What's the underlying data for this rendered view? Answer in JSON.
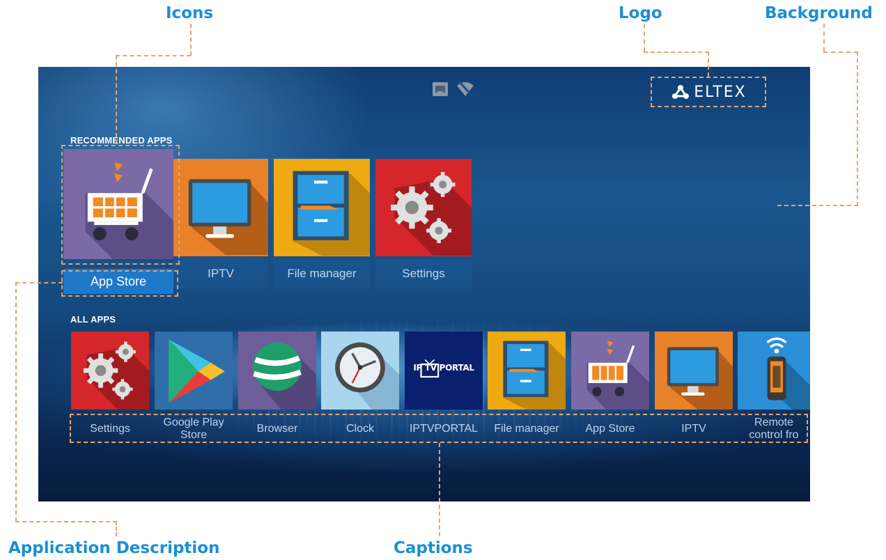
{
  "annotations": {
    "icons": "Icons",
    "logo": "Logo",
    "background": "Background",
    "application_description": "Application Description",
    "captions": "Captions"
  },
  "screen": {
    "logo_text": "ELTEX",
    "status_icons": [
      "ethernet-icon",
      "wifi-off-icon"
    ],
    "recommended": {
      "label": "RECOMMENDED APPS",
      "apps": [
        {
          "caption": "App Store",
          "icon": "shopping-cart-icon",
          "color": "#7b6aa6",
          "selected": true
        },
        {
          "caption": "IPTV",
          "icon": "tv-monitor-icon",
          "color": "#e8822a"
        },
        {
          "caption": "File manager",
          "icon": "file-cabinet-icon",
          "color": "#efa912"
        },
        {
          "caption": "Settings",
          "icon": "gears-icon",
          "color": "#d4262b"
        }
      ]
    },
    "all_apps": {
      "label": "ALL APPS",
      "apps": [
        {
          "caption": "Settings",
          "icon": "gears-icon",
          "color": "#d4262b"
        },
        {
          "caption": "Google Play Store",
          "icon": "play-store-icon",
          "color": "#2f6ea8"
        },
        {
          "caption": "Browser",
          "icon": "globe-icon",
          "color": "#6e5d99"
        },
        {
          "caption": "Clock",
          "icon": "clock-icon",
          "color": "#a9d6ef"
        },
        {
          "caption": "IPTVPORTAL",
          "icon": "iptvportal-logo-icon",
          "color": "#0a1f6d",
          "logo_text": "IP TV PORTAL"
        },
        {
          "caption": "File manager",
          "icon": "file-cabinet-icon",
          "color": "#efa912"
        },
        {
          "caption": "App Store",
          "icon": "shopping-cart-icon",
          "color": "#7b6aa6"
        },
        {
          "caption": "IPTV",
          "icon": "tv-monitor-icon",
          "color": "#e8822a"
        },
        {
          "caption": "Remote control fro",
          "icon": "remote-control-icon",
          "color": "#2a8fd6"
        }
      ]
    }
  }
}
